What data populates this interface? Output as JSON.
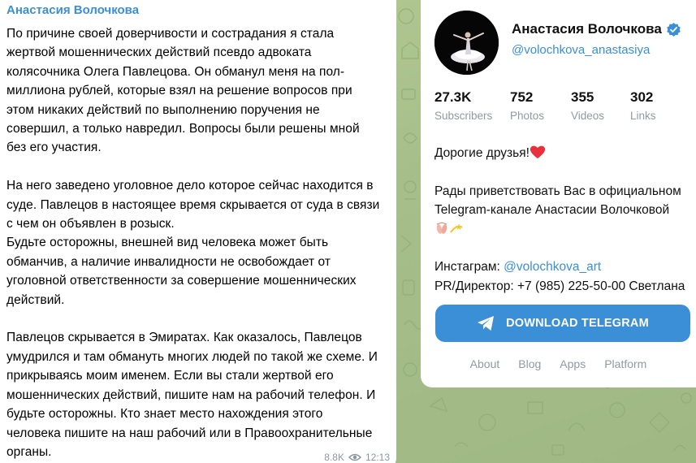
{
  "message": {
    "author": "Анастасия Волочкова",
    "lines": [
      "По причине своей доверчивости и сострадания я стала",
      "жертвой мошеннических действий псевдо адвоката",
      "колясочника Олега Павлецова. Он обманул меня на пол-",
      "миллиона рублей, которые взял на решение вопросов при",
      "этом никаких действий по выполнению поручения не",
      "совершил, а только навредил. Вопросы были решены мной",
      "без его участия.",
      "",
      "На него заведено уголовное дело которое сейчас находится в",
      "суде. Павлецов в настоящее время скрывается от суда в связи",
      "с чем он объявлен в розыск.",
      "Будьте осторожны, внешней вид человека может быть",
      "обманчив, а наличие инвалидности не освобождает от",
      "уголовной ответственности за совершение мошеннических",
      "действий.",
      "",
      "Павлецов скрывается в Эмиратах. Как оказалось, Павлецов",
      "умудрился и там обмануть многих людей по такой же схеме. И",
      "прикрываясь моим именем. Если вы стали жертвой его",
      "мошеннических действий, пишите нам на рабочий телефон. И",
      "будьте осторожны. Кто знает место нахождения этого",
      "человека пишите на наш рабочий или в Правоохранительные",
      "органы."
    ],
    "views": "8.8K",
    "time": "12:13",
    "icons": {
      "views": "eye-icon"
    }
  },
  "channel": {
    "name": "Анастасия Волочкова",
    "handle": "@volochkova_anastasiya",
    "verified": true,
    "stats": [
      {
        "value": "27.3K",
        "label": "Subscribers"
      },
      {
        "value": "752",
        "label": "Photos"
      },
      {
        "value": "355",
        "label": "Videos"
      },
      {
        "value": "302",
        "label": "Links"
      }
    ],
    "greeting": "Дорогие друзья!",
    "welcome": "Рады приветствовать Вас в официальном Telegram-канале Анастасии Волочковой",
    "instagram_label": "Инстаграм:",
    "instagram_handle": "@volochkova_art",
    "pr_contact": "PR/Директор: +7 (985) 225-50-00 Светлана"
  },
  "download_button": {
    "label": "DOWNLOAD TELEGRAM"
  },
  "footer": {
    "links": [
      "About",
      "Blog",
      "Apps",
      "Platform"
    ]
  },
  "colors": {
    "accent": "#3a8fd6",
    "background": "#a9c18f",
    "muted": "#8f9aa4",
    "heart": "#e8313c"
  }
}
